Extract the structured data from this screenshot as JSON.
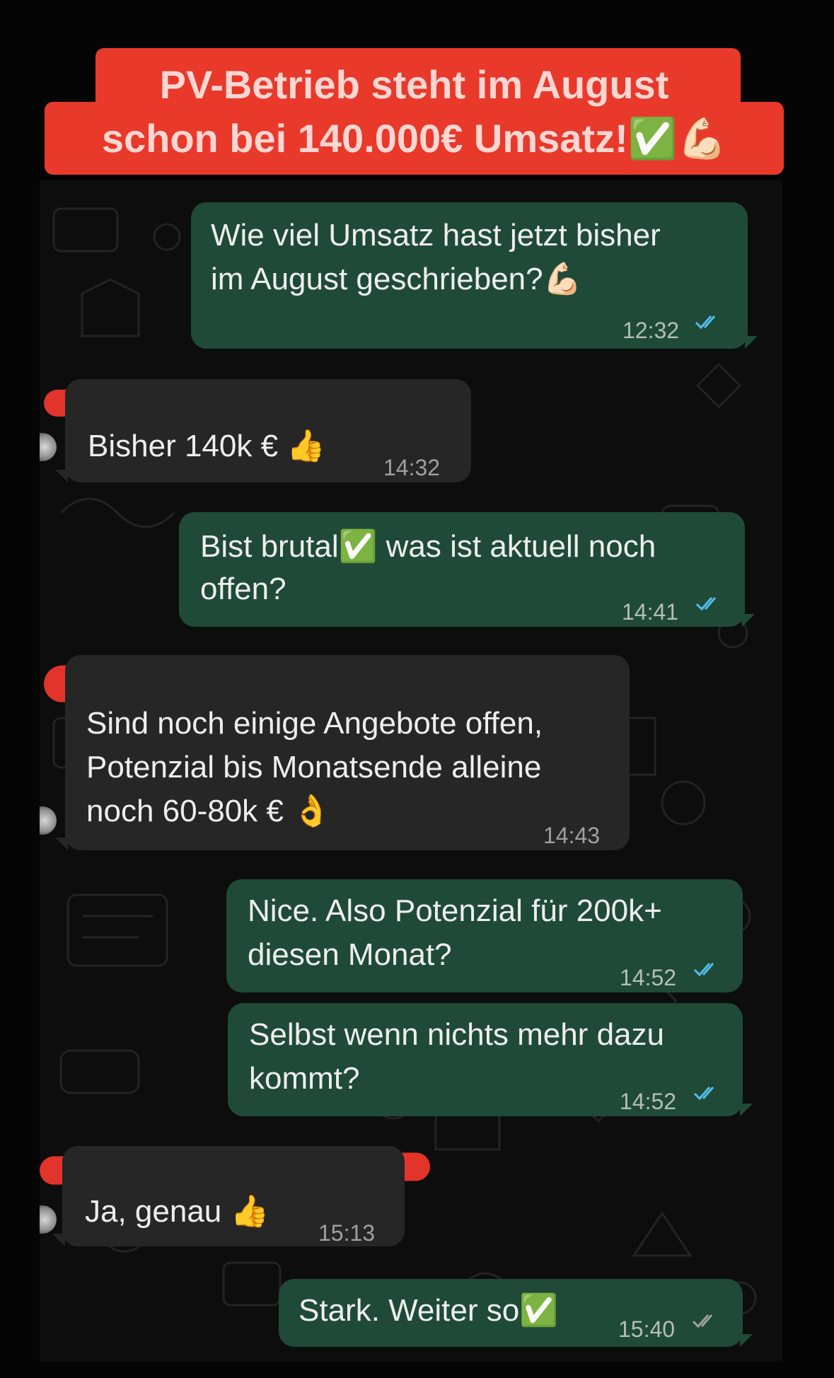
{
  "headline": {
    "line1": "PV-Betrieb steht im August",
    "line2": "schon bei 140.000€ Umsatz!✅💪🏻"
  },
  "colors": {
    "accent_red": "#e8392b",
    "outgoing_bubble": "#1f4a38",
    "incoming_bubble": "#262626",
    "read_ticks": "#53bdeb",
    "delivered_ticks": "#a0a0a0"
  },
  "messages": [
    {
      "direction": "outgoing",
      "lines": [
        "Wie viel Umsatz hast jetzt bisher",
        "im August geschrieben?💪🏻"
      ],
      "time": "12:32",
      "status": "read"
    },
    {
      "direction": "incoming",
      "lines": [
        "Bisher 140k € 👍"
      ],
      "time": "14:32"
    },
    {
      "direction": "outgoing",
      "lines": [
        "Bist brutal✅ was ist aktuell noch",
        "offen?"
      ],
      "time": "14:41",
      "status": "read"
    },
    {
      "direction": "incoming",
      "lines": [
        "Sind noch einige Angebote offen,",
        "Potenzial bis Monatsende alleine",
        "noch 60-80k € 👌"
      ],
      "time": "14:43"
    },
    {
      "direction": "outgoing",
      "lines": [
        "Nice. Also Potenzial für 200k+",
        "diesen Monat?"
      ],
      "time": "14:52",
      "status": "read"
    },
    {
      "direction": "outgoing",
      "lines": [
        "Selbst wenn nichts mehr dazu",
        "kommt?"
      ],
      "time": "14:52",
      "status": "read"
    },
    {
      "direction": "incoming",
      "lines": [
        "Ja, genau 👍"
      ],
      "time": "15:13"
    },
    {
      "direction": "outgoing",
      "lines": [
        "Stark. Weiter so✅"
      ],
      "time": "15:40",
      "status": "delivered"
    }
  ],
  "icons": [
    "double-check-icon",
    "thumbs-up-emoji",
    "ok-hand-emoji",
    "check-mark-emoji",
    "flexed-biceps-emoji"
  ]
}
